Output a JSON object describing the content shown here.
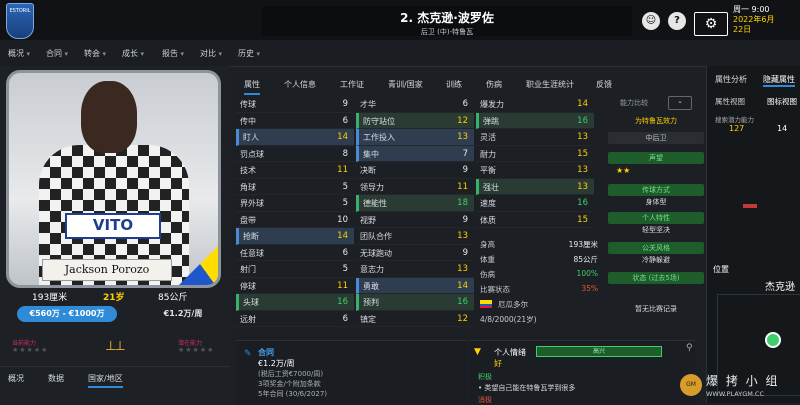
{
  "header": {
    "club_badge": "ESTORIL",
    "player_title": "2. 杰克逊·波罗佐",
    "player_subtitle": "后卫 (中)-特鲁瓦",
    "date_line1": "周一 9:00",
    "date_line2": "2022年6月",
    "date_line3": "22日"
  },
  "menu": [
    "概况",
    "合同",
    "转会",
    "成长",
    "报告",
    "对比",
    "历史"
  ],
  "player_card": {
    "sponsor": "VITO",
    "name_plate": "Jackson Porozo",
    "height": "193厘米",
    "age": "21岁",
    "weight": "85公斤",
    "value": "€560万 - €1000万",
    "wage": "€1.2万/周",
    "left_label": "当前能力",
    "right_label": "潜在能力"
  },
  "left_tabs": [
    "概况",
    "数据",
    "国家/地区"
  ],
  "attr_tabs": [
    "属性",
    "个人信息",
    "工作证",
    "青训/国家",
    "训练",
    "伤病",
    "职业生涯统计",
    "反馈"
  ],
  "technical": [
    {
      "l": "传球",
      "v": "9"
    },
    {
      "l": "传中",
      "v": "6"
    },
    {
      "l": "盯人",
      "v": "14"
    },
    {
      "l": "罚点球",
      "v": "8"
    },
    {
      "l": "技术",
      "v": "11"
    },
    {
      "l": "角球",
      "v": "5"
    },
    {
      "l": "界外球",
      "v": "5"
    },
    {
      "l": "盘带",
      "v": "10"
    },
    {
      "l": "抢断",
      "v": "14"
    },
    {
      "l": "任意球",
      "v": "6"
    },
    {
      "l": "射门",
      "v": "5"
    },
    {
      "l": "停球",
      "v": "11"
    },
    {
      "l": "头球",
      "v": "16"
    },
    {
      "l": "远射",
      "v": "6"
    }
  ],
  "mental": [
    {
      "l": "才华",
      "v": "6"
    },
    {
      "l": "防守站位",
      "v": "12"
    },
    {
      "l": "工作投入",
      "v": "13"
    },
    {
      "l": "集中",
      "v": "7"
    },
    {
      "l": "决断",
      "v": "9"
    },
    {
      "l": "领导力",
      "v": "11"
    },
    {
      "l": "德能性",
      "v": "18"
    },
    {
      "l": "视野",
      "v": "9"
    },
    {
      "l": "团队合作",
      "v": "13"
    },
    {
      "l": "无球跑动",
      "v": "9"
    },
    {
      "l": "意志力",
      "v": "13"
    },
    {
      "l": "勇敢",
      "v": "14"
    },
    {
      "l": "预判",
      "v": "16"
    },
    {
      "l": "镇定",
      "v": "12"
    }
  ],
  "physical": [
    {
      "l": "爆发力",
      "v": "14"
    },
    {
      "l": "弹跳",
      "v": "16"
    },
    {
      "l": "灵活",
      "v": "13"
    },
    {
      "l": "耐力",
      "v": "15"
    },
    {
      "l": "平衡",
      "v": "13"
    },
    {
      "l": "强壮",
      "v": "13"
    },
    {
      "l": "速度",
      "v": "16"
    },
    {
      "l": "体质",
      "v": "15"
    }
  ],
  "bio": [
    {
      "l": "身高",
      "r": "193厘米"
    },
    {
      "l": "体重",
      "r": "85公斤"
    },
    {
      "l": "伤病",
      "r": "100%"
    },
    {
      "l": "比赛状态",
      "r": "35%"
    },
    {
      "l": "厄瓜多尔",
      "r": ""
    },
    {
      "l": "4/8/2000(21岁)",
      "r": ""
    }
  ],
  "role": {
    "compare": "能力比较",
    "best_role_title": "为特鲁瓦效力",
    "best_role": "中后卫",
    "rating_label": "声望",
    "rating_stars": "★★",
    "style_label": "传球方式",
    "style_val": "身体型",
    "trait_label": "个人特性",
    "trait_val": "轻型坚决",
    "public_label": "公关风格",
    "public_val": "冷静躲避",
    "status_label": "状态 (过去5场)",
    "history_label": "暂无比赛记录"
  },
  "right_panel": {
    "tab1": "属性分析",
    "tab2": "隐藏属性",
    "sub1": "属性视图",
    "sub2": "图标视图",
    "stat_label": "搜索潜力能力",
    "stat_val": "127",
    "stat_val2": "14",
    "pos_label": "位置",
    "pos_name": "杰克逊"
  },
  "contract": {
    "title": "合同",
    "wage": "€1.2万/周",
    "line1": "(税后工资€7000/周)",
    "line2": "3项奖金/个附加条款",
    "line3": "5年合同 (30/6/2027)"
  },
  "status": {
    "title": "个人情绪",
    "mood": "好",
    "morale_bar": "高兴",
    "section": "积极",
    "bullet": "类望自己能在特鲁瓦学到很多",
    "section2": "消极"
  },
  "watermark": "爆 拷 小 组",
  "watermark_url": "WWW.PLAYGM.CC"
}
